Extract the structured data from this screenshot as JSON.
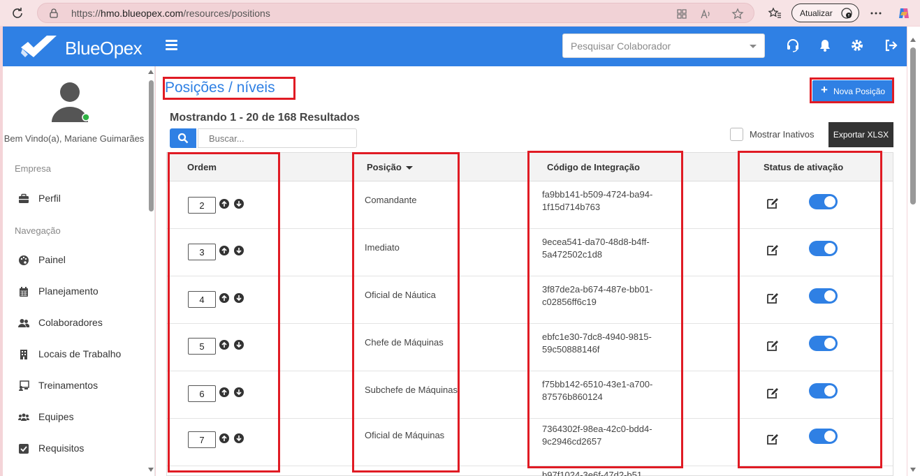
{
  "browser": {
    "url_prefix": "https://",
    "url_host": "hmo.blueopex.com",
    "url_path": "/resources/positions",
    "update_label": "Atualizar"
  },
  "header": {
    "brand": "BlueOpex",
    "search_placeholder": "Pesquisar Colaborador",
    "accent": "#2f80e4"
  },
  "sidebar": {
    "welcome": "Bem Vindo(a), Mariane Guimarães",
    "sections": [
      {
        "title": "Empresa"
      },
      {
        "title": "Navegação"
      }
    ],
    "items": [
      {
        "label": "Perfil",
        "icon": "briefcase-icon"
      },
      {
        "label": "Painel",
        "icon": "palette-icon"
      },
      {
        "label": "Planejamento",
        "icon": "calendar-icon"
      },
      {
        "label": "Colaboradores",
        "icon": "users-icon"
      },
      {
        "label": "Locais de Trabalho",
        "icon": "building-icon"
      },
      {
        "label": "Treinamentos",
        "icon": "chalkboard-icon"
      },
      {
        "label": "Equipes",
        "icon": "team-icon"
      },
      {
        "label": "Requisitos",
        "icon": "checkbox-icon"
      }
    ]
  },
  "main": {
    "title": "Posições / níveis",
    "new_button": "Nova Posição",
    "results": "Mostrando 1 - 20 de 168 Resultados",
    "search_placeholder": "Buscar...",
    "show_inactive": "Mostrar Inativos",
    "export_button": "Exportar XLSX",
    "columns": [
      "Ordem",
      "Posição",
      "Código de Integração",
      "Status de ativação"
    ],
    "rows": [
      {
        "order": "2",
        "position": "Comandante",
        "code1": "fa9bb141-b509-4724-ba94-",
        "code2": "1f15d714b763",
        "active": true
      },
      {
        "order": "3",
        "position": "Imediato",
        "code1": "9ecea541-da70-48d8-b4ff-",
        "code2": "5a472502c1d8",
        "active": true
      },
      {
        "order": "4",
        "position": "Oficial de Náutica",
        "code1": "3f87de2a-b674-487e-bb01-",
        "code2": "c02856ff6c19",
        "active": true
      },
      {
        "order": "5",
        "position": "Chefe de Máquinas",
        "code1": "ebfc1e30-7dc8-4940-9815-",
        "code2": "59c50888146f",
        "active": true
      },
      {
        "order": "6",
        "position": "Subchefe de Máquinas",
        "code1": "f75bb142-6510-43e1-a700-",
        "code2": "87576b860124",
        "active": true
      },
      {
        "order": "7",
        "position": "Oficial de Máquinas",
        "code1": "7364302f-98ea-42c0-bdd4-",
        "code2": "9c2946cd2657",
        "active": true
      }
    ],
    "partial_code": "b97f1024-3e6f-47d2-b51"
  }
}
